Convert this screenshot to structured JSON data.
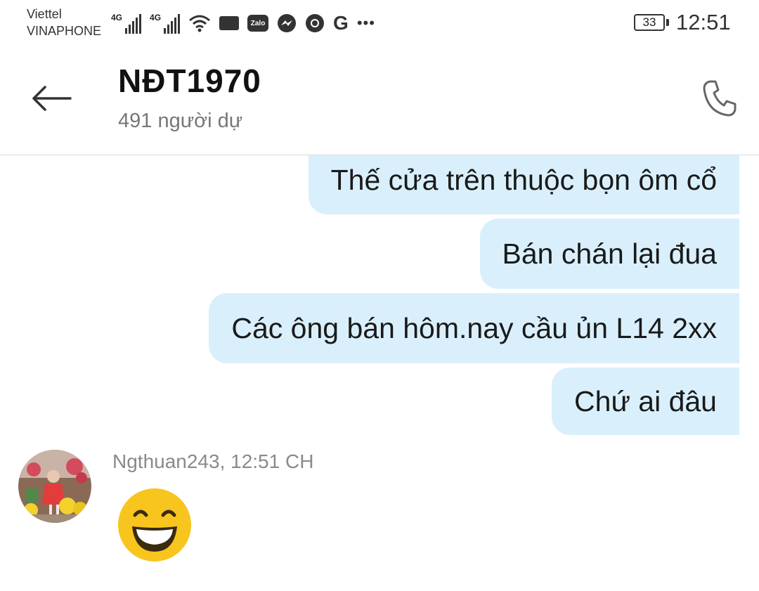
{
  "status_bar": {
    "carrier1": "Viettel",
    "carrier2": "VINAPHONE",
    "net1": "4G",
    "net2": "4G",
    "zalo": "Zalo",
    "g": "G",
    "more": "•••",
    "battery": "33",
    "time": "12:51"
  },
  "header": {
    "title": "NĐT1970",
    "subtitle": "491 người dự"
  },
  "messages": [
    {
      "text": "Thế cửa trên thuộc bọn ôm cổ"
    },
    {
      "text": "Bán chán lại đua"
    },
    {
      "text": "Các ông bán hôm.nay cầu ủn L14 2xx"
    },
    {
      "text": "Chứ ai đâu"
    }
  ],
  "incoming": {
    "sender_line": "Ngthuan243, 12:51 CH",
    "emoji": "grinning-face-with-smiling-eyes"
  },
  "colors": {
    "bubble": "#d9f0fc",
    "emoji": "#f7c51e"
  }
}
